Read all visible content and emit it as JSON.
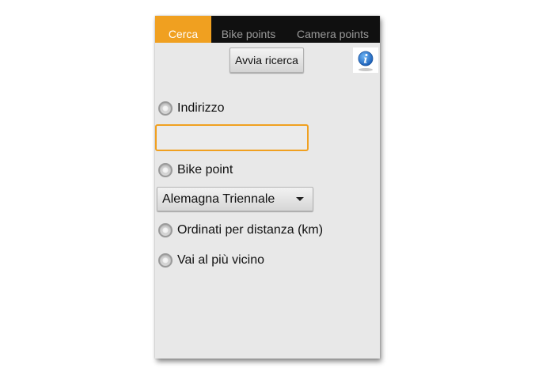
{
  "tabs": [
    {
      "label": "Cerca",
      "active": true
    },
    {
      "label": "Bike points",
      "active": false
    },
    {
      "label": "Camera points",
      "active": false
    }
  ],
  "toolbar": {
    "search_label": "Avvia ricerca",
    "info_icon": "info-icon"
  },
  "options": {
    "address_label": "Indirizzo",
    "address_value": "",
    "bike_point_label": "Bike point",
    "bike_point_selected": "Alemagna Triennale",
    "distance_label": "Ordinati per distanza (km)",
    "nearest_label": "Vai al più vicino"
  },
  "colors": {
    "accent": "#f0a020",
    "tabbar": "#101010",
    "background": "#e8e8e8"
  }
}
